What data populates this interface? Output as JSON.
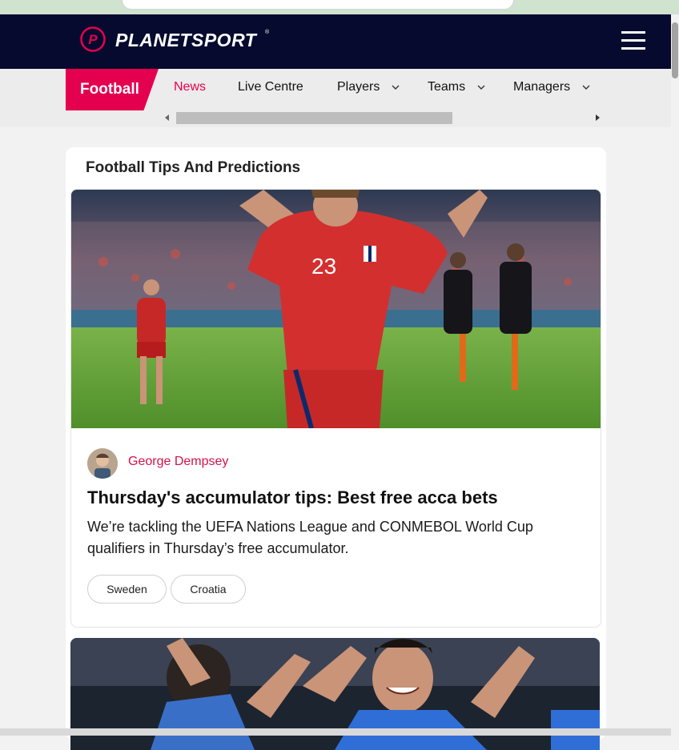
{
  "brand": {
    "name": "PLANETSPORT",
    "mark_letter": "P",
    "registered": "®",
    "accent_color": "#e5004f",
    "header_bg": "#050a2e"
  },
  "header": {
    "menu_icon": "hamburger-menu-icon"
  },
  "nav": {
    "section": "Football",
    "items": [
      {
        "label": "News",
        "active": true,
        "has_dropdown": false
      },
      {
        "label": "Live Centre",
        "active": false,
        "has_dropdown": false
      },
      {
        "label": "Players",
        "active": false,
        "has_dropdown": true
      },
      {
        "label": "Teams",
        "active": false,
        "has_dropdown": true
      },
      {
        "label": "Managers",
        "active": false,
        "has_dropdown": true
      }
    ]
  },
  "section_title": "Football Tips And Predictions",
  "articles": [
    {
      "image": "norway-player-celebrating-photo",
      "author": "George Dempsey",
      "title": "Thursday's accumulator tips: Best free acca bets",
      "summary": "We’re tackling the UEFA Nations League and CONMEBOL World Cup qualifiers in Thursday’s free accumulator.",
      "tags": [
        "Sweden",
        "Croatia"
      ]
    },
    {
      "image": "italy-players-celebrating-photo"
    }
  ],
  "photo_details": {
    "shirt_number": "23"
  }
}
